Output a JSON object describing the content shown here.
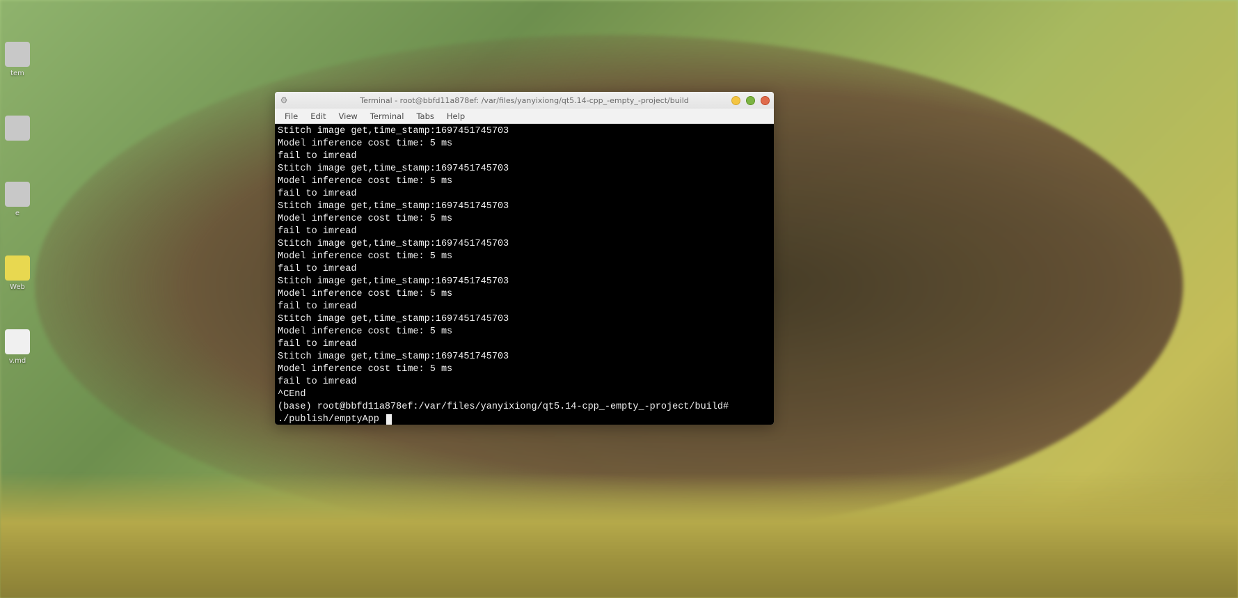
{
  "desktop_icons": [
    {
      "label": "tem",
      "style": "ico-gray"
    },
    {
      "label": "",
      "style": "ico-gray"
    },
    {
      "label": "e",
      "style": "ico-gray"
    },
    {
      "label": "Web",
      "style": "ico-yellow"
    },
    {
      "label": "v.md",
      "style": "ico-white"
    }
  ],
  "window": {
    "title": "Terminal - root@bbfd11a878ef: /var/files/yanyixiong/qt5.14-cpp_-empty_-project/build",
    "menus": [
      "File",
      "Edit",
      "View",
      "Terminal",
      "Tabs",
      "Help"
    ]
  },
  "terminal": {
    "repeated_block": [
      "Stitch image get,time_stamp:1697451745703",
      "Model inference cost time: 5 ms",
      "fail to imread"
    ],
    "repeat_count": 7,
    "end_signal": "^CEnd",
    "prompt": "(base) root@bbfd11a878ef:/var/files/yanyixiong/qt5.14-cpp_-empty_-project/build#",
    "command": "./publish/emptyApp"
  }
}
